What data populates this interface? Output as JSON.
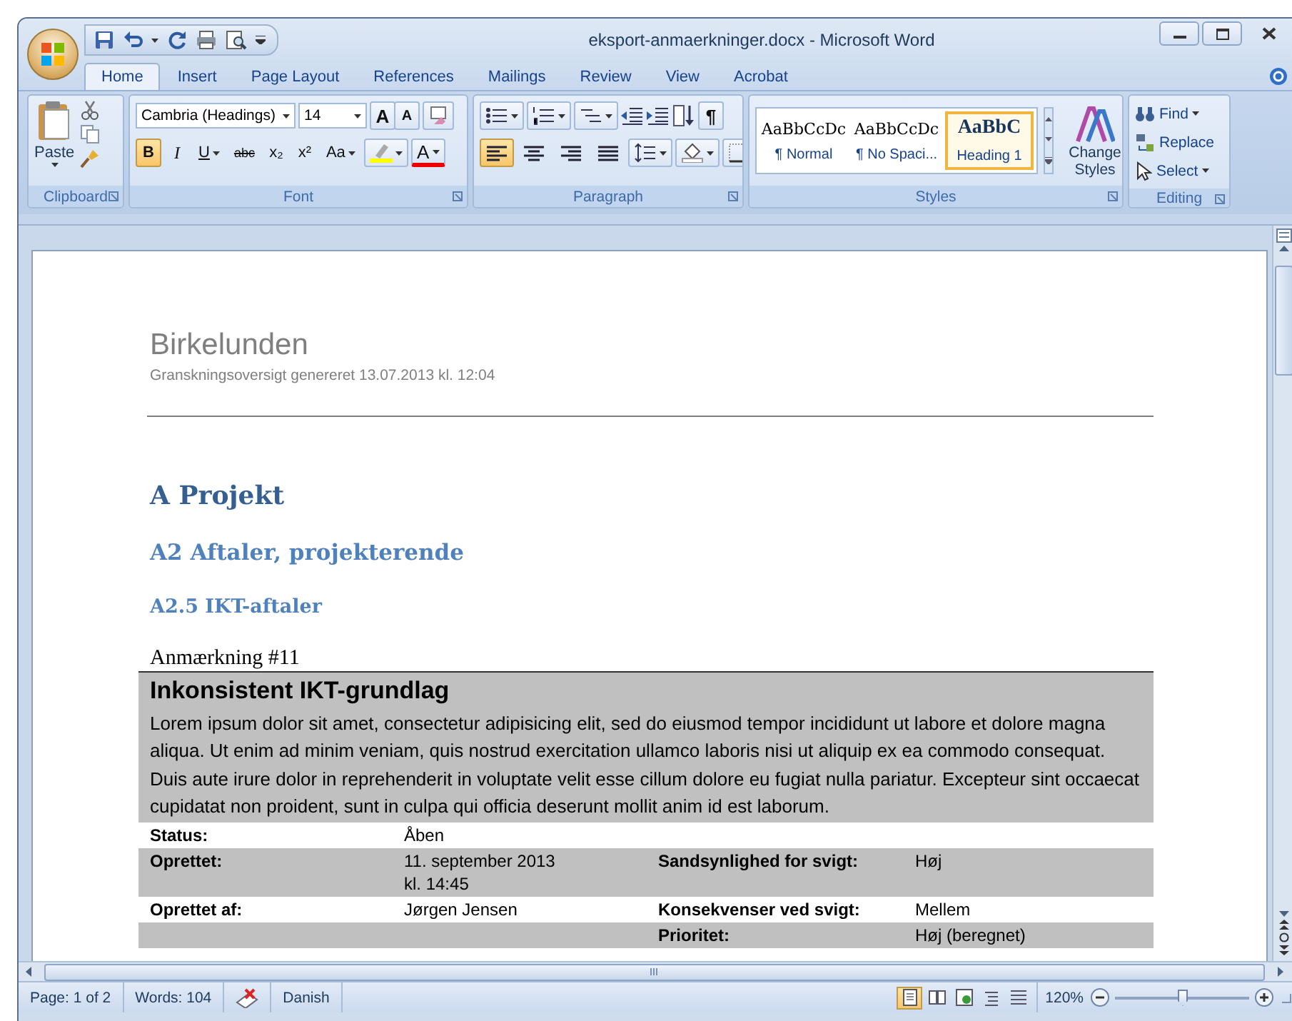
{
  "window": {
    "title": "eksport-anmaerkninger.docx - Microsoft Word"
  },
  "tabs": [
    {
      "label": "Home",
      "selected": true
    },
    {
      "label": "Insert",
      "selected": false
    },
    {
      "label": "Page Layout",
      "selected": false
    },
    {
      "label": "References",
      "selected": false
    },
    {
      "label": "Mailings",
      "selected": false
    },
    {
      "label": "Review",
      "selected": false
    },
    {
      "label": "View",
      "selected": false
    },
    {
      "label": "Acrobat",
      "selected": false
    }
  ],
  "ribbon": {
    "clipboard": {
      "label": "Clipboard",
      "paste": "Paste"
    },
    "font": {
      "label": "Font",
      "font_name": "Cambria (Headings)",
      "font_size": "14",
      "grow": "A",
      "shrink": "A",
      "font_color": "A",
      "format_buttons": [
        {
          "kind": "bold",
          "label": "B"
        },
        {
          "kind": "italic",
          "label": "I"
        },
        {
          "kind": "underline",
          "label": "U"
        },
        {
          "kind": "strike",
          "label": "abc"
        },
        {
          "kind": "subscript",
          "label": "x₂"
        },
        {
          "kind": "superscript",
          "label": "x²"
        },
        {
          "kind": "case",
          "label": "Aa"
        }
      ]
    },
    "paragraph": {
      "label": "Paragraph",
      "pilcrow": "¶",
      "alignments": [
        {
          "kind": "left",
          "selected": true
        },
        {
          "kind": "center",
          "selected": false
        },
        {
          "kind": "right",
          "selected": false
        },
        {
          "kind": "justify",
          "selected": false
        }
      ]
    },
    "styles": {
      "label": "Styles",
      "change_styles": "Change Styles",
      "gallery": [
        {
          "preview": "AaBbCcDc",
          "name": "¶ Normal",
          "selected": false
        },
        {
          "preview": "AaBbCcDc",
          "name": "¶ No Spaci...",
          "selected": false
        },
        {
          "preview": "AaBbC",
          "name": "Heading 1",
          "selected": true
        }
      ]
    },
    "editing": {
      "label": "Editing",
      "find": "Find",
      "replace": "Replace",
      "select": "Select"
    }
  },
  "document": {
    "title": "Birkelunden",
    "subtitle": "Granskningsoversigt genereret 13.07.2013 kl. 12:04",
    "headings": [
      {
        "kind": "heading_1",
        "text": "A Projekt"
      },
      {
        "kind": "heading_2",
        "text": "A2 Aftaler, projekterende"
      },
      {
        "kind": "heading_3",
        "text": "A2.5 IKT-aftaler"
      }
    ],
    "note": {
      "label": "Anmærkning #11",
      "title": "Inkonsistent IKT-grundlag",
      "body": "Lorem ipsum dolor sit amet, consectetur adipisicing elit, sed do eiusmod tempor incididunt ut labore et dolore magna aliqua. Ut enim ad minim veniam, quis nostrud exercitation ullamco laboris nisi ut aliquip ex ea commodo consequat. Duis aute irure dolor in reprehenderit in voluptate velit esse cillum dolore eu fugiat nulla pariatur. Excepteur sint occaecat cupidatat non proident, sunt in culpa qui officia deserunt mollit anim id est laborum.",
      "fields": [
        {
          "label_1": "Status:",
          "value_1": "Åben"
        },
        {
          "label_1": "Oprettet:",
          "value_1": "11. september 2013\nkl. 14:45",
          "label_2": "Sandsynlighed for svigt:",
          "value_2": "Høj"
        },
        {
          "label_1": "Oprettet af:",
          "value_1": "Jørgen Jensen",
          "label_2": "Konsekvenser ved svigt:",
          "value_2": "Mellem"
        },
        {
          "label_2": "Prioritet:",
          "value_2": "Høj (beregnet)"
        }
      ]
    }
  },
  "status_bar": {
    "page": "Page: 1 of 2",
    "words": "Words: 104",
    "language": "Danish",
    "views": [
      {
        "kind": "print_layout",
        "selected": true
      },
      {
        "kind": "full_screen",
        "selected": false
      },
      {
        "kind": "web_layout",
        "selected": false
      },
      {
        "kind": "outline",
        "selected": false
      },
      {
        "kind": "draft",
        "selected": false
      }
    ],
    "zoom": {
      "reading": "120%",
      "level": 0.5
    }
  }
}
